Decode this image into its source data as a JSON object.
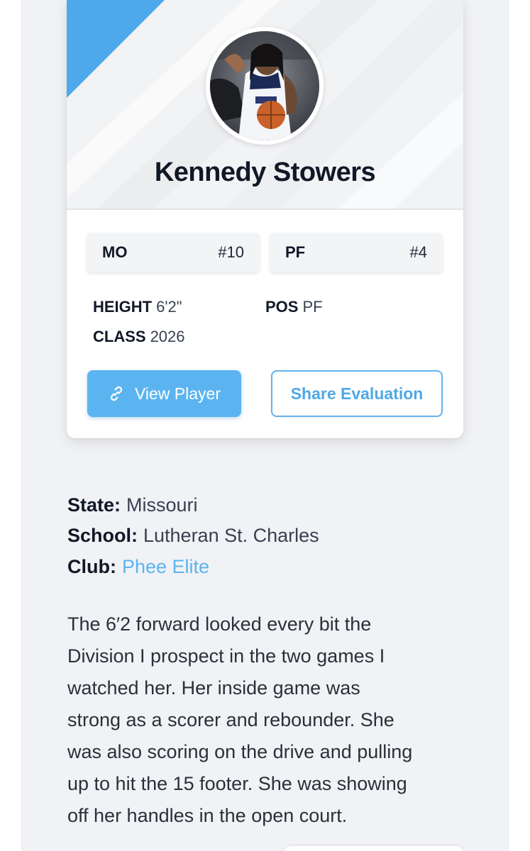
{
  "player": {
    "name": "Kennedy Stowers",
    "state_abbr": "MO",
    "jersey_number": "#10",
    "position_abbr": "PF",
    "position_rank": "#4",
    "height_label": "HEIGHT",
    "height_value": "6'2\"",
    "pos_label": "POS",
    "pos_value": "PF",
    "class_label": "CLASS",
    "class_value": "2026"
  },
  "actions": {
    "view_player_label": "View Player",
    "share_evaluation_label": "Share Evaluation"
  },
  "details": {
    "state_label": "State:",
    "state_value": "Missouri",
    "school_label": "School:",
    "school_value": "Lutheran St. Charles",
    "club_label": "Club:",
    "club_value": "Phee Elite"
  },
  "evaluation": {
    "lines": [
      "The 6′2 forward looked every bit the",
      "Division I prospect in the two games I",
      "watched her. Her inside game was",
      "strong as a scorer and rebounder. She",
      "was also scoring on the drive and pulling",
      "up to hit the 15 footer. She was showing",
      "off her handles in the open court."
    ]
  },
  "colors": {
    "accent_blue": "#5bb4f0",
    "corner_blue": "#4ea9ec",
    "page_bg": "#f1f2f5",
    "text_dark": "#111827"
  },
  "icons": {
    "button_icon": "link-icon",
    "avatar": "player-photo"
  }
}
